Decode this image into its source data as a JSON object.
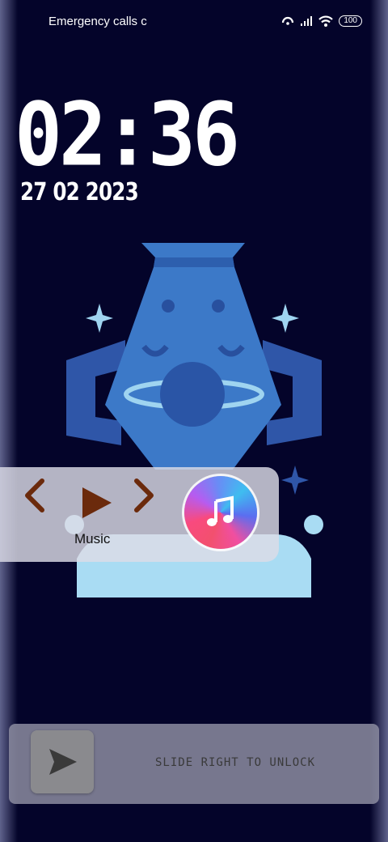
{
  "status_bar": {
    "carrier_text": "Emergency calls c",
    "battery": "100",
    "icons": [
      "hotspot-icon",
      "signal-icon",
      "wifi-icon",
      "battery-icon"
    ]
  },
  "clock": {
    "time": "02:36",
    "date": "27 02 2023"
  },
  "wallpaper": {
    "subject": "aquarius-vase-illustration"
  },
  "music_widget": {
    "label": "Music",
    "controls": [
      "previous-icon",
      "play-icon",
      "next-icon"
    ],
    "app_icon": "apple-music-icon"
  },
  "unlock": {
    "text": "SLIDE RIGHT TO UNLOCK"
  },
  "colors": {
    "background": "#04042a",
    "accent_control": "#6b2a0c",
    "widget_bg": "#dcdce6"
  }
}
